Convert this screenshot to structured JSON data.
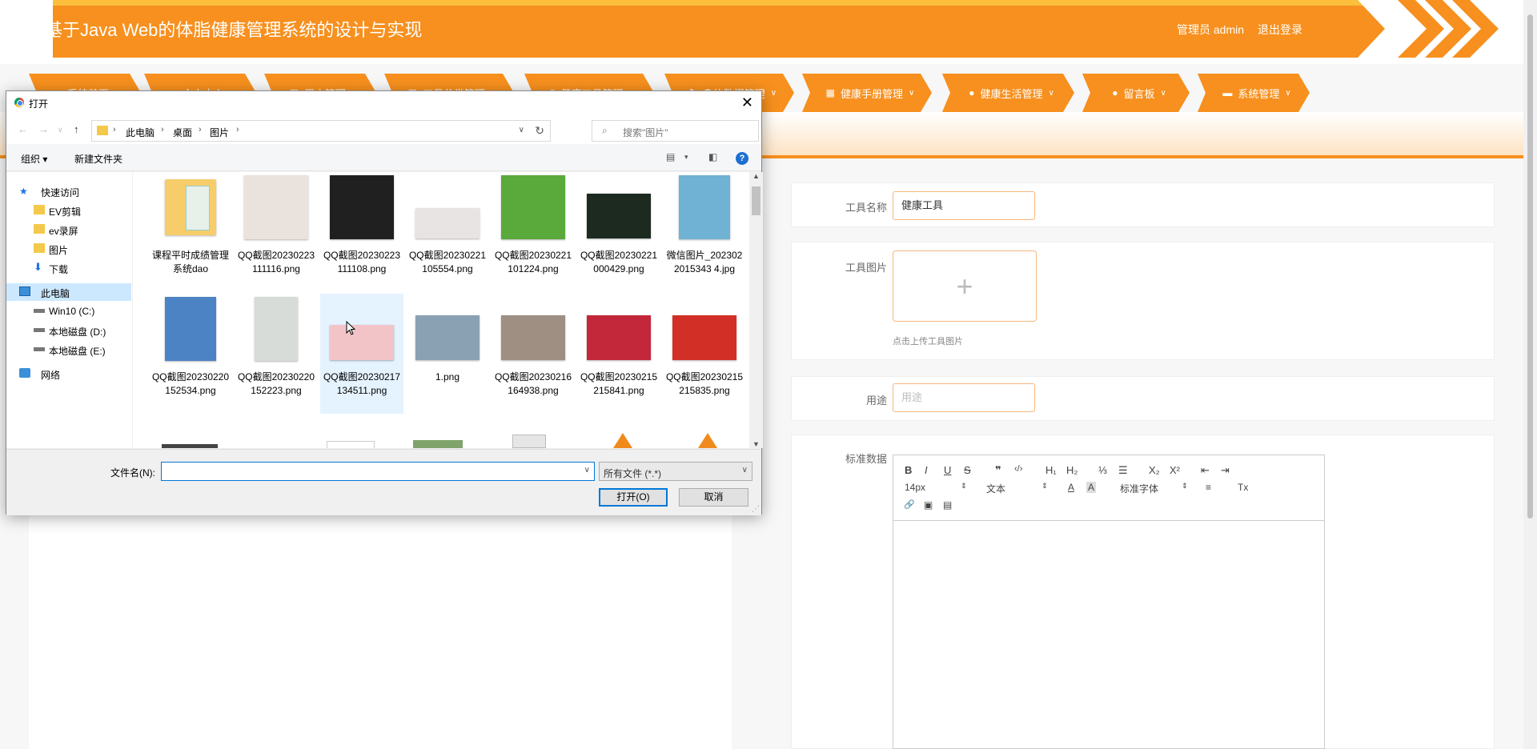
{
  "header": {
    "title": "基于Java Web的体脂健康管理系统的设计与实现",
    "user": "管理员 admin",
    "logout": "退出登录"
  },
  "nav": {
    "items": [
      {
        "label": "系统首页",
        "icon": "home-icon"
      },
      {
        "label": "个人中心",
        "icon": "user-icon"
      },
      {
        "label": "用户管理",
        "icon": "grid-icon"
      },
      {
        "label": "工具分类管理",
        "icon": "grid-icon"
      },
      {
        "label": "健康工具管理",
        "icon": "chart-icon"
      },
      {
        "label": "身体数据管理",
        "icon": "flag-icon"
      },
      {
        "label": "健康手册管理",
        "icon": "grid-icon"
      },
      {
        "label": "健康生活管理",
        "icon": "user-icon"
      },
      {
        "label": "留言板",
        "icon": "pin-icon"
      },
      {
        "label": "系统管理",
        "icon": "print-icon"
      }
    ]
  },
  "form": {
    "tool_name_label": "工具名称",
    "tool_name_value": "健康工具",
    "tool_image_label": "工具图片",
    "upload_plus": "+",
    "upload_hint": "点击上传工具图片",
    "usage_label": "用途",
    "usage_placeholder": "用途",
    "standard_label": "标准数据"
  },
  "editor": {
    "bold": "B",
    "italic": "I",
    "underline": "U",
    "strike": "S",
    "quote": "❞",
    "code": "‹/›",
    "h1": "H₁",
    "h2": "H₂",
    "ol": "⅓",
    "ul": "☰",
    "sub": "X₂",
    "sup": "X²",
    "outdent": "⇤",
    "indent": "⇥",
    "size": "14px",
    "format": "文本",
    "color": "A",
    "bg": "A",
    "font": "标准字体",
    "align": "≡",
    "clear": "Tx",
    "link": "🔗",
    "image": "▣",
    "video": "▤"
  },
  "dialog": {
    "title": "打开",
    "breadcrumb": [
      "此电脑",
      "桌面",
      "图片"
    ],
    "search_placeholder": "搜索\"图片\"",
    "organize": "组织 ▾",
    "new_folder": "新建文件夹",
    "tree": [
      {
        "label": "快速访问",
        "icon": "star-icon"
      },
      {
        "label": "EV剪辑",
        "icon": "folder-icon"
      },
      {
        "label": "ev录屏",
        "icon": "folder-icon"
      },
      {
        "label": "图片",
        "icon": "folder-icon"
      },
      {
        "label": "下载",
        "icon": "download-icon"
      },
      {
        "label": "此电脑",
        "icon": "computer-icon"
      },
      {
        "label": "Win10 (C:)",
        "icon": "drive-icon"
      },
      {
        "label": "本地磁盘 (D:)",
        "icon": "drive-icon"
      },
      {
        "label": "本地磁盘 (E:)",
        "icon": "drive-icon"
      },
      {
        "label": "网络",
        "icon": "network-icon"
      }
    ],
    "files": [
      {
        "name": "课程平时成绩管理系统dao",
        "kind": "folder"
      },
      {
        "name": "QQ截图20230223111116.png",
        "kind": "image",
        "color": "#e9e2dd"
      },
      {
        "name": "QQ截图20230223111108.png",
        "kind": "image",
        "color": "#202020"
      },
      {
        "name": "QQ截图20230221105554.png",
        "kind": "image",
        "color": "#e8e4e4"
      },
      {
        "name": "QQ截图20230221101224.png",
        "kind": "image",
        "color": "#5aa93b"
      },
      {
        "name": "QQ截图20230221000429.png",
        "kind": "image",
        "color": "#1c2a20"
      },
      {
        "name": "微信图片_2023022015343 4.jpg",
        "kind": "image",
        "color": "#6fb2d3"
      },
      {
        "name": "QQ截图20230220152534.png",
        "kind": "image",
        "color": "#4c83c4"
      },
      {
        "name": "QQ截图20230220152223.png",
        "kind": "image",
        "color": "#d8dcd8"
      },
      {
        "name": "QQ截图20230217134511.png",
        "kind": "image",
        "color": "#f2c4c8"
      },
      {
        "name": "1.png",
        "kind": "image",
        "color": "#8aa1b4"
      },
      {
        "name": "QQ截图20230216164938.png",
        "kind": "image",
        "color": "#9e8f82"
      },
      {
        "name": "QQ截图20230215215841.png",
        "kind": "image",
        "color": "#c3283a"
      },
      {
        "name": "QQ截图20230215215835.png",
        "kind": "image",
        "color": "#d23026"
      }
    ],
    "filename_label": "文件名(N):",
    "filename_value": "",
    "filetype": "所有文件 (*.*)",
    "open_button": "打开(O)",
    "cancel_button": "取消"
  }
}
